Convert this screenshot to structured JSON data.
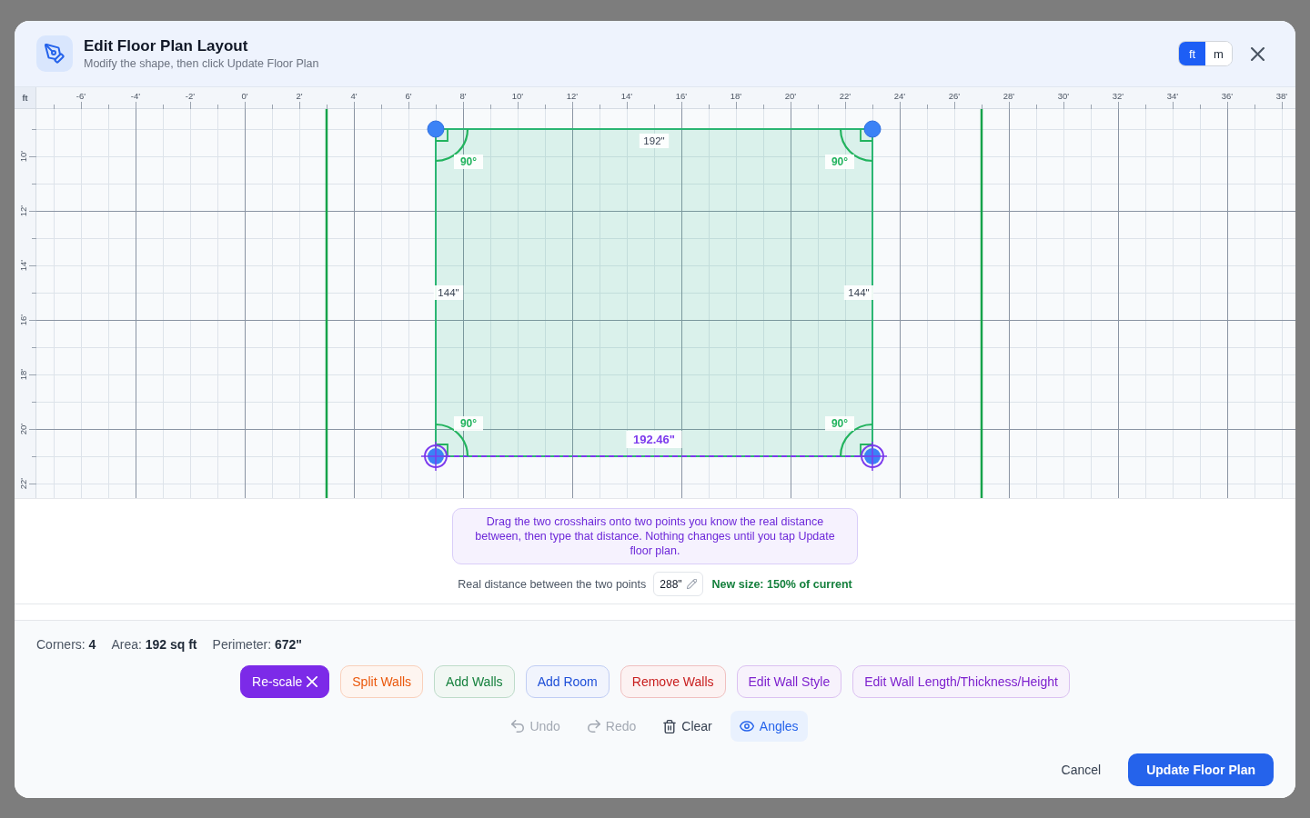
{
  "dialog": {
    "title": "Edit Floor Plan Layout",
    "subtitle": "Modify the shape, then click Update Floor Plan"
  },
  "units": [
    {
      "label": "ft",
      "selected": true
    },
    {
      "label": "m",
      "selected": false
    }
  ],
  "ruler": {
    "unit": "ft",
    "x_labels": [
      "-6'",
      "-4'",
      "-2'",
      "0'",
      "2'",
      "4'",
      "6'",
      "8'",
      "10'",
      "12'",
      "14'",
      "16'",
      "18'",
      "20'",
      "22'",
      "24'",
      "26'",
      "28'",
      "30'",
      "32'",
      "34'",
      "36'",
      "38'"
    ],
    "y_labels": [
      "10'",
      "12'",
      "14'",
      "16'",
      "18'",
      "20'",
      "22'"
    ]
  },
  "plan": {
    "walls": [
      {
        "label": "192\""
      },
      {
        "label": "144\""
      },
      {
        "label": "144\""
      }
    ],
    "corners": [
      {
        "angle": "90°",
        "kind": "dot"
      },
      {
        "angle": "90°",
        "kind": "dot"
      },
      {
        "angle": "90°",
        "kind": "crosshair"
      },
      {
        "angle": "90°",
        "kind": "crosshair"
      }
    ],
    "measure": {
      "label": "192.46\""
    }
  },
  "rescale": {
    "instructions": "Drag the two crosshairs onto two points you know the real distance between, then type that distance. Nothing changes until you tap Update floor plan.",
    "distance_label": "Real distance between the two points",
    "distance_value": "288\"",
    "result": "New size: 150% of current"
  },
  "stats": [
    "Corners: **4**",
    "Area: **192 sq ft**",
    "Perimeter: **672\"**"
  ],
  "tools": [
    {
      "label": "Re-scale",
      "color": "#7c2ae8",
      "selected": true
    },
    {
      "label": "Split Walls",
      "color": "#ea580c",
      "selected": false
    },
    {
      "label": "Add Walls",
      "color": "#15803d",
      "selected": false
    },
    {
      "label": "Add Room",
      "color": "#1d4ed8",
      "selected": false
    },
    {
      "label": "Remove Walls",
      "color": "#c81e1e",
      "selected": false
    },
    {
      "label": "Edit Wall Style",
      "color": "#7e22ce",
      "selected": false
    },
    {
      "label": "Edit Wall Length/Thickness/Height",
      "color": "#7e22ce",
      "selected": false
    }
  ],
  "actions": [
    {
      "kind": "undo",
      "label": "Undo",
      "disabled": true,
      "on": false
    },
    {
      "kind": "redo",
      "label": "Redo",
      "disabled": true,
      "on": false
    },
    {
      "kind": "delete",
      "label": "Clear",
      "disabled": false,
      "on": false
    },
    {
      "kind": "toggle",
      "label": "Angles",
      "disabled": false,
      "on": true
    }
  ],
  "footer_buttons": [
    {
      "kind": "secondary",
      "label": "Cancel"
    },
    {
      "kind": "primary",
      "label": "Update Floor Plan"
    }
  ]
}
